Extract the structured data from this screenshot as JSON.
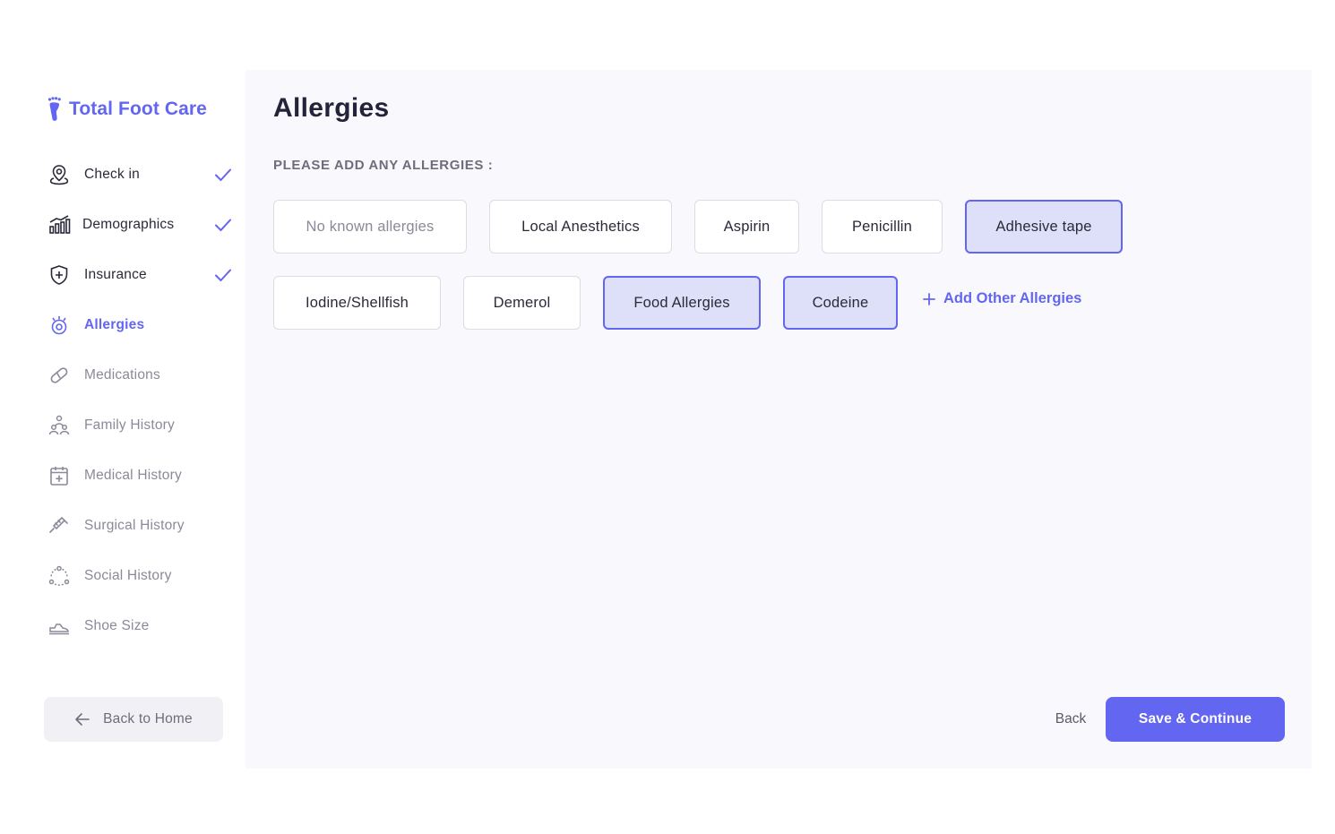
{
  "brand": {
    "name": "Total Foot Care",
    "accent": "#6366f1"
  },
  "sidebar": {
    "items": [
      {
        "label": "Check in",
        "icon": "location-pin-icon",
        "state": "done"
      },
      {
        "label": "Demographics",
        "icon": "bar-chart-icon",
        "state": "done"
      },
      {
        "label": "Insurance",
        "icon": "shield-plus-icon",
        "state": "done"
      },
      {
        "label": "Allergies",
        "icon": "allergy-icon",
        "state": "active"
      },
      {
        "label": "Medications",
        "icon": "pill-icon",
        "state": "todo"
      },
      {
        "label": "Family History",
        "icon": "family-icon",
        "state": "todo"
      },
      {
        "label": "Medical History",
        "icon": "calendar-plus-icon",
        "state": "todo"
      },
      {
        "label": "Surgical History",
        "icon": "syringe-icon",
        "state": "todo"
      },
      {
        "label": "Social History",
        "icon": "social-circle-icon",
        "state": "todo"
      },
      {
        "label": "Shoe Size",
        "icon": "shoe-icon",
        "state": "todo"
      }
    ],
    "back_home_label": "Back to Home"
  },
  "main": {
    "title": "Allergies",
    "section_label": "PLEASE ADD ANY ALLERGIES :",
    "chips": [
      {
        "label": "No known allergies",
        "selected": false
      },
      {
        "label": "Local Anesthetics",
        "selected": false
      },
      {
        "label": "Aspirin",
        "selected": false
      },
      {
        "label": "Penicillin",
        "selected": false
      },
      {
        "label": "Adhesive tape",
        "selected": true
      },
      {
        "label": "Iodine/Shellfish",
        "selected": false
      },
      {
        "label": "Demerol",
        "selected": false
      },
      {
        "label": "Food Allergies",
        "selected": true
      },
      {
        "label": "Codeine",
        "selected": true
      }
    ],
    "add_other_label": "Add Other Allergies",
    "back_label": "Back",
    "save_label": "Save & Continue"
  }
}
